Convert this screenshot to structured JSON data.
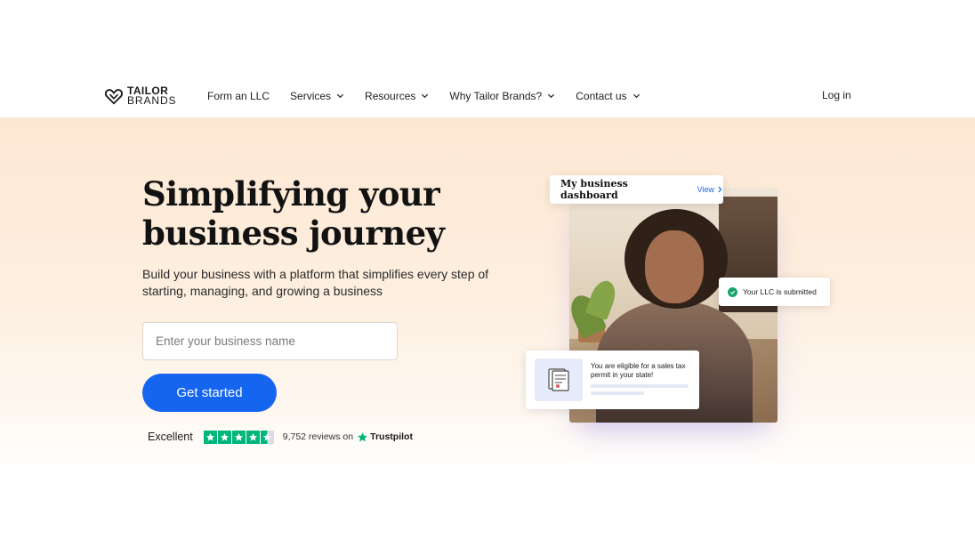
{
  "brand": {
    "line1": "TAILOR",
    "line2": "BRANDS",
    "icon": "tailor-brands-heart-logo-icon"
  },
  "nav": {
    "items": [
      {
        "label": "Form an LLC",
        "has_dropdown": false
      },
      {
        "label": "Services",
        "has_dropdown": true
      },
      {
        "label": "Resources",
        "has_dropdown": true
      },
      {
        "label": "Why Tailor Brands?",
        "has_dropdown": true
      },
      {
        "label": "Contact us",
        "has_dropdown": true
      }
    ],
    "login_label": "Log in"
  },
  "hero": {
    "headline": "Simplifying your business journey",
    "subtext": "Build your business with a platform that simplifies every step of starting, managing, and growing a business",
    "input_placeholder": "Enter your business name",
    "input_value": "",
    "cta_label": "Get started"
  },
  "trust": {
    "rating_word": "Excellent",
    "stars": 4.5,
    "reviews_text": "9,752 reviews on",
    "brand": "Trustpilot",
    "star_color": "#00b67a"
  },
  "collage": {
    "dashboard_title": "My business dashboard",
    "dashboard_link": "View",
    "llc_status": "Your LLC is submitted",
    "tax_message": "You are eligible for a sales tax permit in your state!"
  },
  "colors": {
    "accent": "#1565f0",
    "hero_bg": "#fde8d3",
    "success": "#1aa36b"
  }
}
